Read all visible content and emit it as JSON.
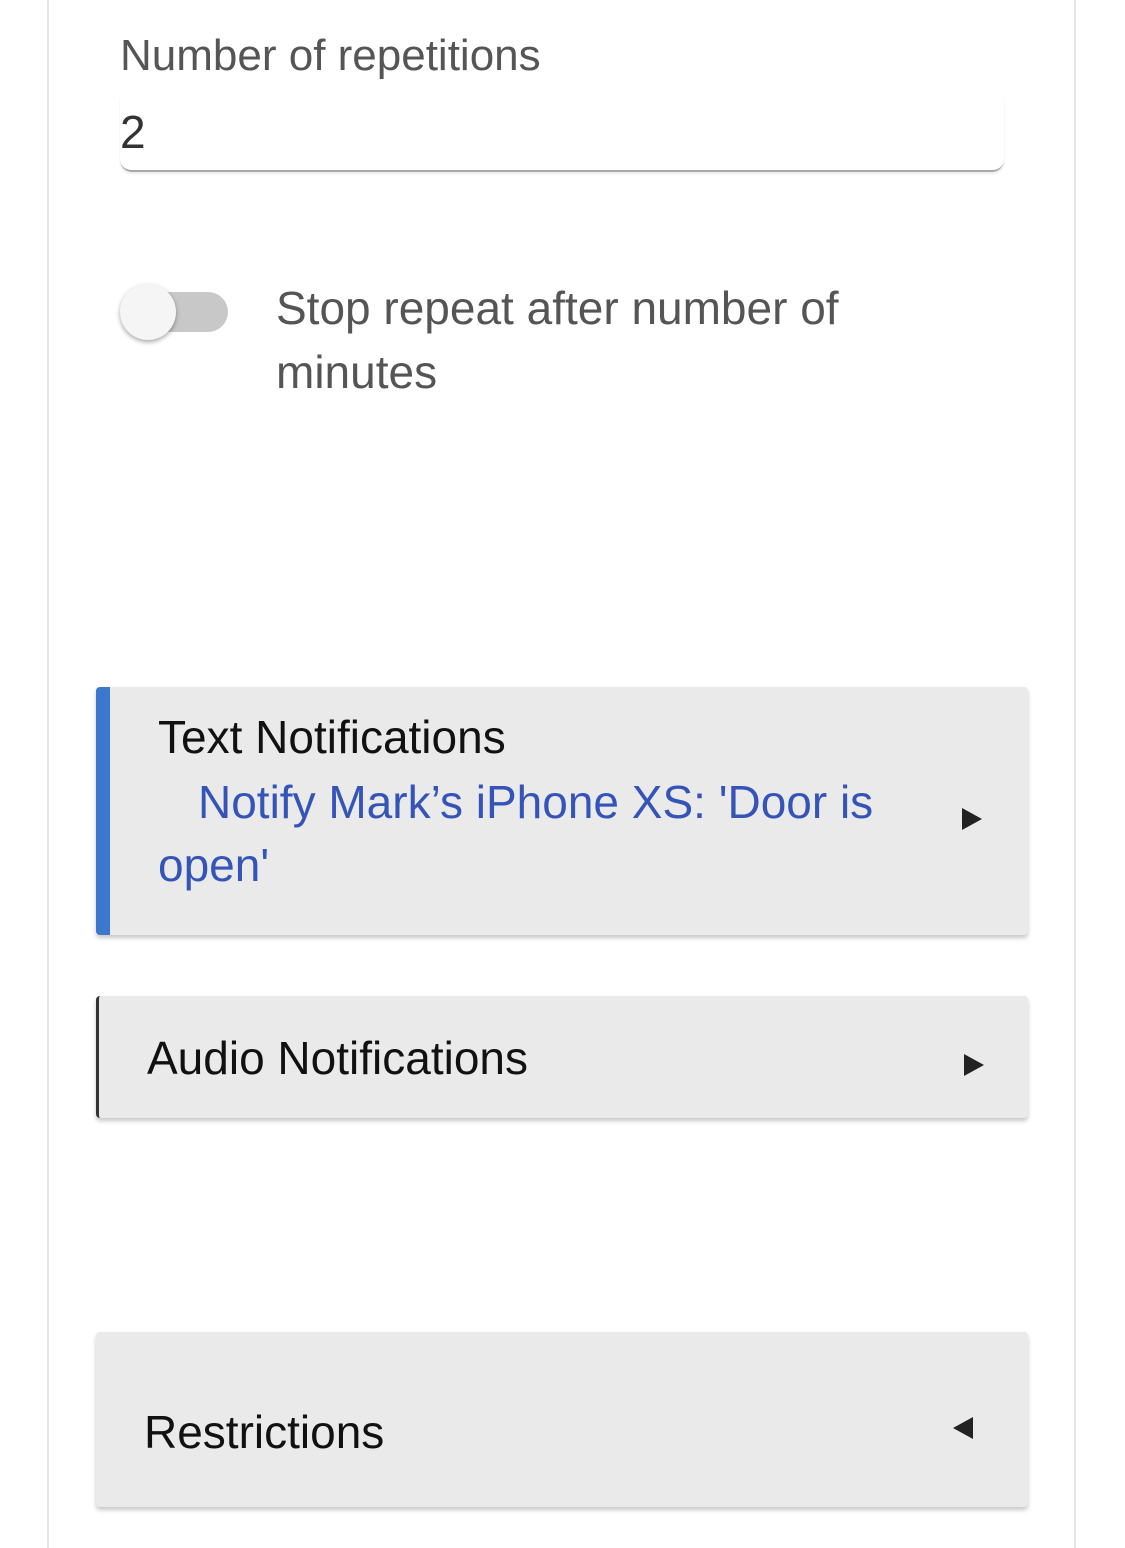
{
  "repetitions": {
    "label": "Number of repetitions",
    "value": "2"
  },
  "stop_repeat": {
    "label": "Stop repeat after number of minutes",
    "enabled": false
  },
  "sections": {
    "text_notifications": {
      "title": "Text Notifications",
      "summary": "Notify Mark’s iPhone XS: 'Door is open'",
      "accent_color": "#3b77cc",
      "arrow": "triangle-right-icon"
    },
    "audio_notifications": {
      "title": "Audio Notifications",
      "arrow": "triangle-right-icon"
    },
    "restrictions": {
      "title": "Restrictions",
      "arrow": "triangle-left-icon"
    }
  }
}
